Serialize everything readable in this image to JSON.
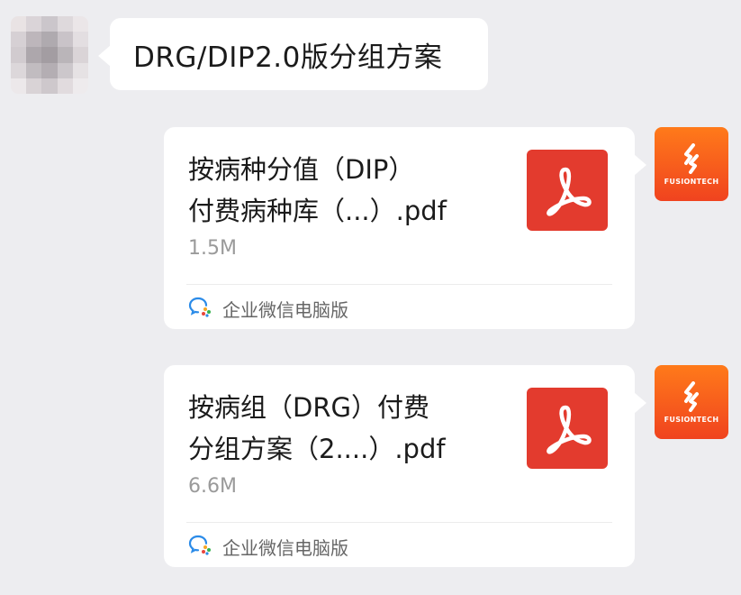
{
  "chat": {
    "incoming_message": "DRG/DIP2.0版分组方案",
    "files": [
      {
        "name_line1": "按病种分值（DIP）",
        "name_line2": "付费病种库（...）.pdf",
        "size": "1.5M",
        "icon": "pdf-icon",
        "source_icon": "wecom-icon",
        "source_label": "企业微信电脑版",
        "sender_logo_text": "FUSIONTECH"
      },
      {
        "name_line1": "按病组（DRG）付费",
        "name_line2": "分组方案（2....）.pdf",
        "size": "6.6M",
        "icon": "pdf-icon",
        "source_icon": "wecom-icon",
        "source_label": "企业微信电脑版",
        "sender_logo_text": "FUSIONTECH"
      }
    ]
  },
  "colors": {
    "background": "#ededf0",
    "bubble": "#ffffff",
    "pdf_red": "#e33b2e",
    "logo_orange": "#f05a1f"
  }
}
